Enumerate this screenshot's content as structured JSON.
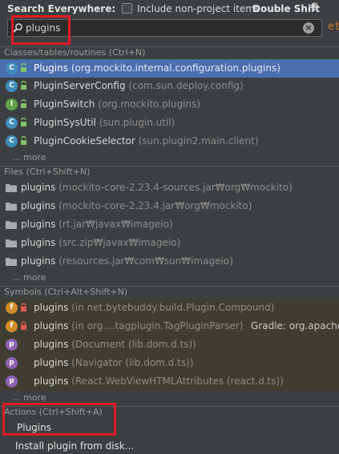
{
  "header": {
    "title": "Search Everywhere:",
    "include_label": "Include non-project items",
    "shortcut": "Double Shift",
    "settings_icon": "gear-icon"
  },
  "search": {
    "value": "plugins",
    "editor_glyph": "et"
  },
  "classes": {
    "header": "Classes/tables/routines (Ctrl+N)",
    "items": [
      {
        "name": "Plugins",
        "location": "(org.mockito.internal.configuration.plugins)",
        "icon": "class-icon"
      },
      {
        "name": "PluginServerConfig",
        "location": "(com.sun.deploy.config)",
        "icon": "class-icon"
      },
      {
        "name": "PluginSwitch",
        "location": "(org.mockito.plugins)",
        "icon": "interface-icon"
      },
      {
        "name": "PluginSysUtil",
        "location": "(sun.plugin.util)",
        "icon": "class-icon"
      },
      {
        "name": "PluginCookieSelector",
        "location": "(sun.plugin2.main.client)",
        "icon": "class-icon"
      }
    ],
    "more": "... more"
  },
  "files": {
    "header": "Files (Ctrl+Shift+N)",
    "items": [
      {
        "name": "plugins",
        "location": "(mockito-core-2.23.4-sources.jar₩org₩mockito)"
      },
      {
        "name": "plugins",
        "location": "(mockito-core-2.23.4.jar₩org₩mockito)"
      },
      {
        "name": "plugins",
        "location": "(rt.jar₩javax₩imageio)"
      },
      {
        "name": "plugins",
        "location": "(src.zip₩javax₩imageio)"
      },
      {
        "name": "plugins",
        "location": "(resources.jar₩com₩sun₩imageio)"
      }
    ],
    "more": "... more"
  },
  "symbols": {
    "header": "Symbols (Ctrl+Alt+Shift+N)",
    "items": [
      {
        "name": "plugins",
        "location": "(in net.bytebuddy.build.Plugin.Compound)",
        "badge": "f",
        "right": ""
      },
      {
        "name": "plugins",
        "location": "(in org....tagplugin.TagPluginParser)",
        "badge": "f",
        "right": "Gradle: org.apache.t"
      },
      {
        "name": "plugins",
        "location": "(Document (lib.dom.d.ts))",
        "badge": "p",
        "right": ""
      },
      {
        "name": "plugins",
        "location": "(Navigator (lib.dom.d.ts))",
        "badge": "p",
        "right": ""
      },
      {
        "name": "plugins",
        "location": "(React.WebViewHTMLAttributes (react.d.ts))",
        "badge": "p",
        "right": ""
      }
    ],
    "more": "... more"
  },
  "actions": {
    "header": "Actions (Ctrl+Shift+A)",
    "items": [
      "Plugins",
      "Install plugin from disk..."
    ]
  }
}
